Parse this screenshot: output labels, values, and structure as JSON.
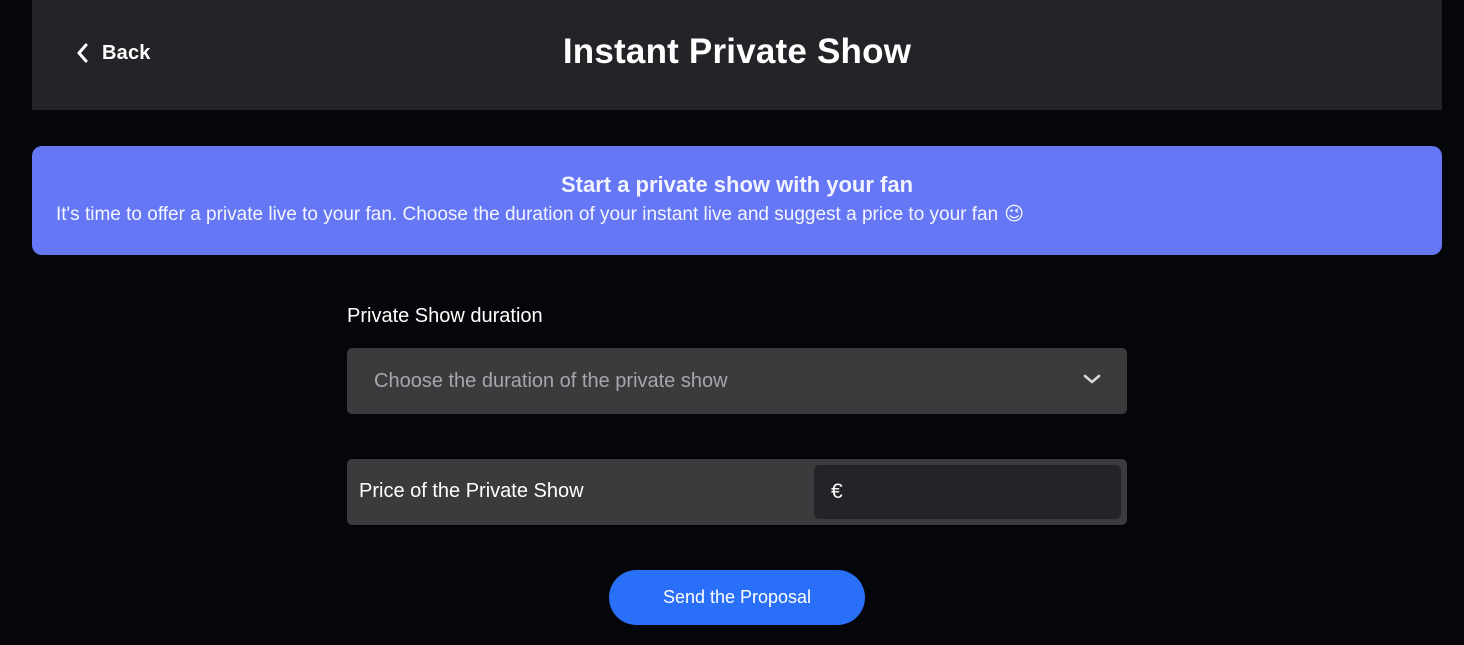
{
  "header": {
    "back_label": "Back",
    "title": "Instant Private Show"
  },
  "banner": {
    "title": "Start a private show with your fan",
    "text": "It's time to offer a private live to your fan. Choose the duration of your instant live and suggest a price to your fan",
    "emoji": "😉",
    "color": "#6577f5"
  },
  "form": {
    "duration_label": "Private Show duration",
    "duration_placeholder": "Choose the duration of the private show",
    "price_label": "Price of the Private Show",
    "currency_symbol": "€",
    "price_value": ""
  },
  "actions": {
    "send_label": "Send the Proposal",
    "send_color": "#2a6ff7"
  },
  "icons": {
    "back": "chevron-left-icon",
    "dropdown": "chevron-down-icon",
    "emoji": "winking-face-icon"
  }
}
